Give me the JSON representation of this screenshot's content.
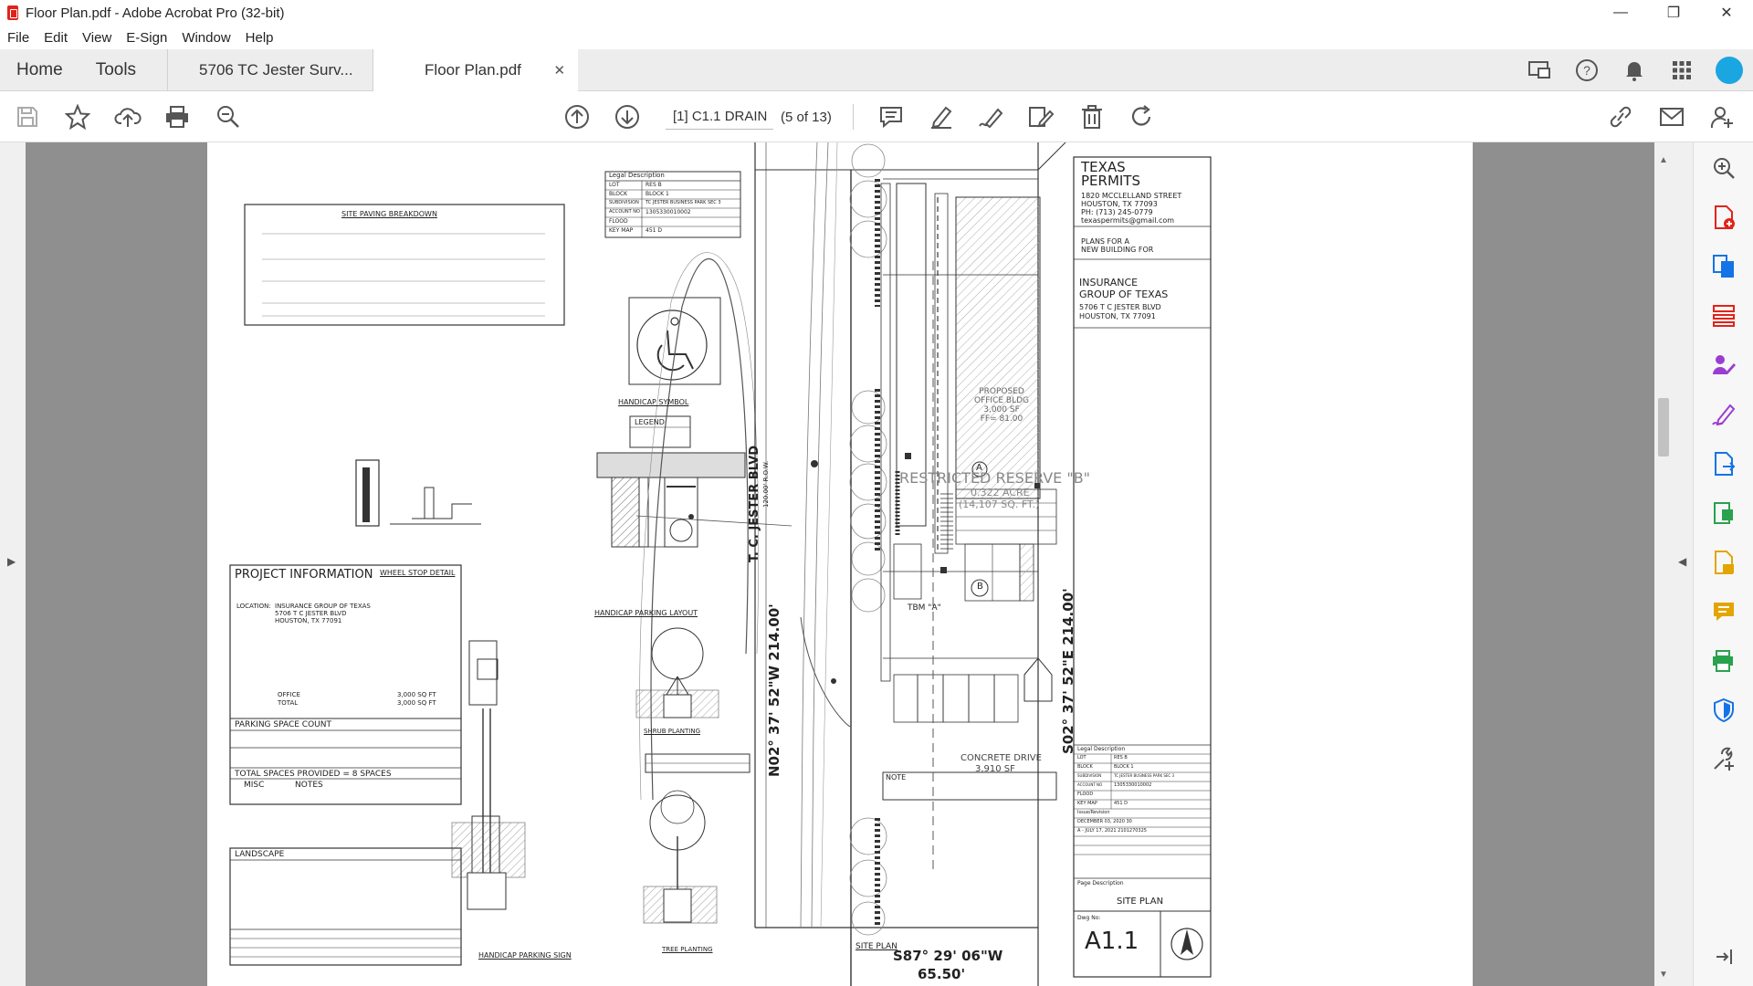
{
  "window": {
    "title": "Floor Plan.pdf - Adobe Acrobat Pro (32-bit)",
    "controls": [
      "—",
      "❐",
      "✕"
    ]
  },
  "menu": [
    "File",
    "Edit",
    "View",
    "E-Sign",
    "Window",
    "Help"
  ],
  "tabs": {
    "home": "Home",
    "tools": "Tools",
    "documents": [
      {
        "label": "5706 TC Jester Surv...",
        "active": false
      },
      {
        "label": "Floor Plan.pdf",
        "active": true
      }
    ],
    "close_glyph": "✕"
  },
  "toolbar": {
    "page_label": "[1] C1.1 DRAIN",
    "page_count": "(5 of 13)"
  },
  "drawing": {
    "site_paving_title": "SITE PAVING BREAKDOWN",
    "legal_description": {
      "title": "Legal Description",
      "rows": [
        [
          "LOT",
          "RES B"
        ],
        [
          "BLOCK",
          "BLOCK 1"
        ],
        [
          "SUBDIVISION",
          "TC JESTER BUSINESS PARK SEC 3"
        ],
        [
          "ACCOUNT NO",
          "1305330010002"
        ],
        [
          "FLOOD",
          ""
        ],
        [
          "KEY MAP",
          "451 D"
        ]
      ]
    },
    "handicap_symbol": "HANDICAP SYMBOL",
    "legend": "LEGEND",
    "wheel_stop": "WHEEL STOP DETAIL",
    "handicap_layout": "HANDICAP PARKING LAYOUT",
    "project_info": {
      "title": "PROJECT INFORMATION",
      "location_label": "LOCATION:",
      "location_lines": [
        "INSURANCE GROUP OF TEXAS",
        "5706 T C JESTER BLVD",
        "HOUSTON, TX 77091"
      ],
      "office": "OFFICE",
      "office_val": "3,000 SQ FT",
      "total": "TOTAL",
      "total_val": "3,000 SQ FT",
      "parking_count": "PARKING SPACE COUNT",
      "total_spaces": "TOTAL SPACES PROVIDED = 8 SPACES",
      "misc": "MISC",
      "notes": "NOTES",
      "landscape": "LANDSCAPE"
    },
    "shrub_planting": "SHRUB PLANTING",
    "tree_planting": "TREE PLANTING",
    "handicap_sign": "HANDICAP PARKING SIGN",
    "street_name": "T. C. JESTER BLVD",
    "street_row": "120.00' R.O.W.",
    "bearing_left": "N02° 37' 52\"W 214.00'",
    "bearing_right": "S02° 37' 52\"E 214.00'",
    "bearing_bottom": "S87° 29' 06\"W",
    "bearing_bottom_len": "65.50'",
    "proposed_office": [
      "PROPOSED",
      "OFFICE BLDG",
      "3,000 SF",
      "FF= 81.00"
    ],
    "restricted_reserve": "RESTRICTED RESERVE \"B\"",
    "reserve_area": "0.322 ACRE",
    "reserve_sqft": "(14,107 SQ. FT.)",
    "marker_a": "A",
    "marker_b": "B",
    "tbm": "TBM \"A\"",
    "concrete_drive": "CONCRETE DRIVE",
    "concrete_drive_area": "3,910 SF",
    "note_title": "NOTE",
    "site_plan_label": "SITE PLAN",
    "title_block": {
      "company": [
        "TEXAS",
        "PERMITS"
      ],
      "address": [
        "1820 MCCLELLAND STREET",
        "HOUSTON, TX 77093",
        "PH: (713) 245-0779",
        "texaspermits@gmail.com"
      ],
      "plans_for": [
        "PLANS FOR A",
        "NEW BUILDING FOR"
      ],
      "client": [
        "INSURANCE",
        "GROUP OF TEXAS"
      ],
      "client_address": [
        "5706 T C JESTER BLVD",
        "HOUSTON, TX 77091"
      ],
      "legal_title": "Legal Description",
      "legal_rows": [
        [
          "LOT",
          "RES B"
        ],
        [
          "BLOCK",
          "BLOCK 1"
        ],
        [
          "SUBDIVISION",
          "TC JESTER BUSINESS PARK SEC 3"
        ],
        [
          "ACCOUNT NO",
          "1305330010002"
        ],
        [
          "FLOOD",
          ""
        ],
        [
          "KEY MAP",
          "451 D"
        ]
      ],
      "issue_label": "Issue/Revision",
      "issue_rows": [
        "DECEMBER 03, 2020 30",
        "A - JULY 17, 2021 2101270325"
      ],
      "page_description_label": "Page Description",
      "page_description": "SITE PLAN",
      "dwg_label": "Dwg No:",
      "dwg_no": "A1.1"
    }
  },
  "colors": {
    "accent_red": "#e2231a",
    "tool_blue": "#1473e6",
    "canvas_gray": "#8f8f8f"
  }
}
